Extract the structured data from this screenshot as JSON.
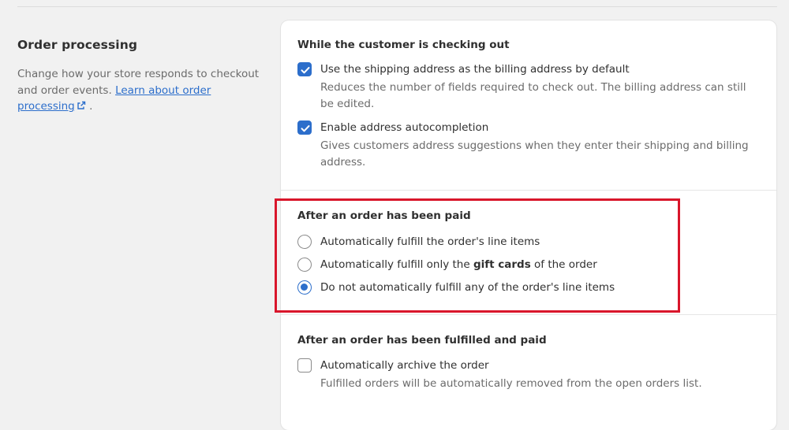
{
  "section": {
    "title": "Order processing",
    "description": "Change how your store responds to checkout and order events.",
    "link_text": "Learn about order processing",
    "trailing": "."
  },
  "checkout_group": {
    "title": "While the customer is checking out",
    "options": [
      {
        "label": "Use the shipping address as the billing address by default",
        "help": "Reduces the number of fields required to check out. The billing address can still be edited.",
        "checked": true
      },
      {
        "label": "Enable address autocompletion",
        "help": "Gives customers address suggestions when they enter their shipping and billing address.",
        "checked": true
      }
    ]
  },
  "paid_group": {
    "title": "After an order has been paid",
    "options": [
      {
        "label": "Automatically fulfill the order's line items",
        "selected": false
      },
      {
        "label_prefix": "Automatically fulfill only the ",
        "label_bold": "gift cards",
        "label_suffix": " of the order",
        "selected": false
      },
      {
        "label": "Do not automatically fulfill any of the order's line items",
        "selected": true
      }
    ]
  },
  "fulfilled_group": {
    "title": "After an order has been fulfilled and paid",
    "options": [
      {
        "label": "Automatically archive the order",
        "help": "Fulfilled orders will be automatically removed from the open orders list.",
        "checked": false
      }
    ]
  },
  "colors": {
    "accent": "#2c6ecb",
    "highlight": "#d9162b",
    "background": "#f1f1f1",
    "card": "#ffffff"
  },
  "icons": {
    "external_link": "external-link-icon",
    "checkmark": "checkmark-icon"
  }
}
